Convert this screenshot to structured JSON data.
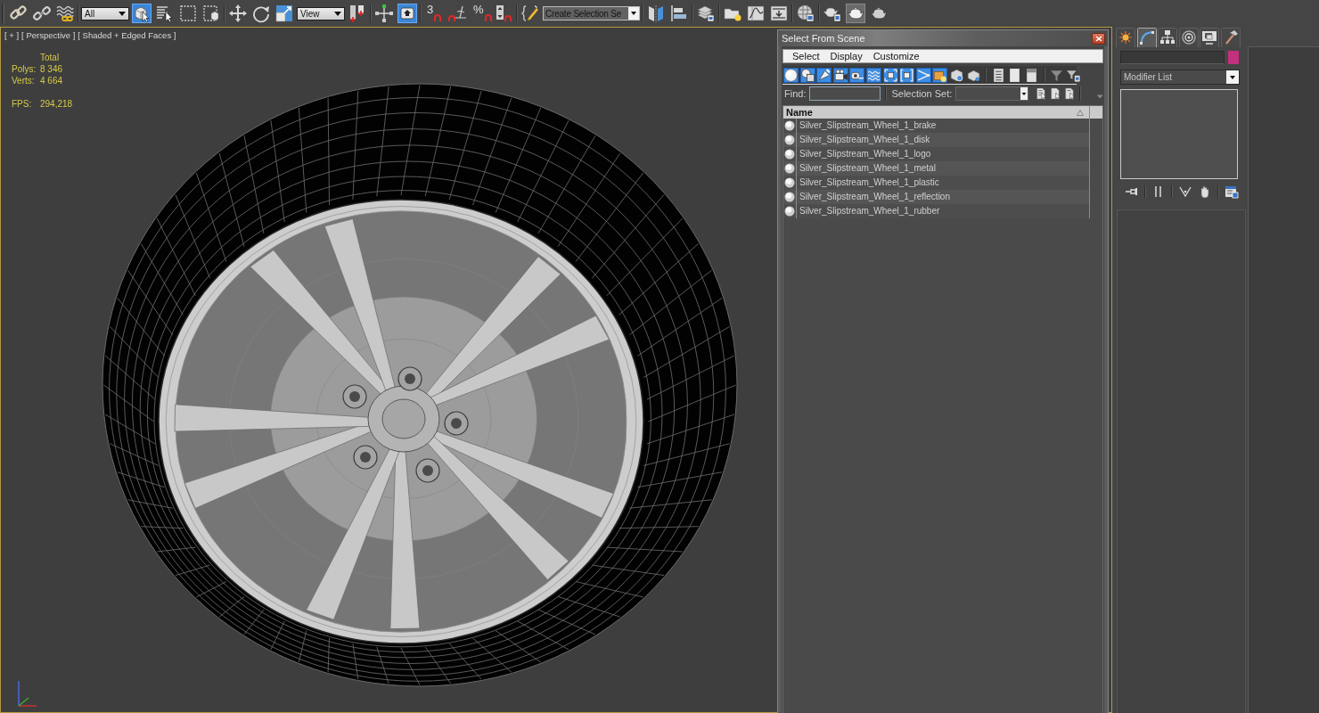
{
  "main_toolbar": {
    "groups": [
      [
        {
          "kind": "button",
          "selected": false,
          "hovered": false
        },
        {
          "kind": "button",
          "selected": false,
          "hovered": false
        },
        {
          "kind": "button",
          "selected": false,
          "hovered": false
        }
      ],
      [
        {
          "kind": "dropdown",
          "value": "All"
        },
        {
          "kind": "button",
          "selected": true,
          "hovered": false
        },
        {
          "kind": "button",
          "selected": false,
          "hovered": false
        },
        {
          "kind": "button",
          "selected": false,
          "hovered": false
        },
        {
          "kind": "button",
          "selected": false,
          "hovered": false
        }
      ],
      [
        {
          "kind": "button",
          "selected": false,
          "hovered": false
        },
        {
          "kind": "button",
          "selected": false,
          "hovered": false
        },
        {
          "kind": "button",
          "selected": false,
          "hovered": false
        },
        {
          "kind": "dropdown",
          "value": "View"
        },
        {
          "kind": "button",
          "selected": false,
          "hovered": false
        }
      ],
      [
        {
          "kind": "button",
          "selected": false,
          "hovered": false
        },
        {
          "kind": "button",
          "selected": true,
          "hovered": false
        }
      ],
      [
        {
          "kind": "snap",
          "label": "3",
          "selected": false,
          "hovered": false
        },
        {
          "kind": "button",
          "selected": false,
          "hovered": false
        },
        {
          "kind": "snap",
          "label": "%",
          "selected": false,
          "hovered": false
        },
        {
          "kind": "button",
          "selected": false,
          "hovered": false
        }
      ],
      [
        {
          "kind": "button",
          "selected": false,
          "hovered": false
        },
        {
          "kind": "combo",
          "placeholder": "Create Selection Se"
        }
      ],
      [
        {
          "kind": "button",
          "selected": false,
          "hovered": false
        },
        {
          "kind": "button",
          "selected": false,
          "hovered": false
        }
      ],
      [
        {
          "kind": "button",
          "selected": false,
          "hovered": false
        }
      ],
      [
        {
          "kind": "button",
          "selected": false,
          "hovered": false
        },
        {
          "kind": "button",
          "selected": false,
          "hovered": false
        },
        {
          "kind": "button",
          "selected": false,
          "hovered": false
        }
      ],
      [
        {
          "kind": "button",
          "selected": false,
          "hovered": false
        }
      ],
      [
        {
          "kind": "button",
          "selected": false,
          "hovered": false
        },
        {
          "kind": "button",
          "selected": false,
          "hovered": true
        },
        {
          "kind": "button",
          "selected": false,
          "hovered": false
        }
      ]
    ]
  },
  "viewport": {
    "active": true,
    "labels": [
      "[ + ]",
      "[ Perspective ]",
      "[ Shaded + Edged Faces ]"
    ],
    "stats": {
      "header": "Total",
      "rows": [
        {
          "label": "Polys:",
          "value": "8 346"
        },
        {
          "label": "Verts:",
          "value": "4 664"
        }
      ],
      "fps": {
        "label": "FPS:",
        "value": "294,218"
      }
    }
  },
  "dialog": {
    "title": "Select From Scene",
    "menu": [
      "Select",
      "Display",
      "Customize"
    ],
    "toolbar": [
      {
        "selected": true
      },
      {
        "selected": true
      },
      {
        "selected": true
      },
      {
        "selected": true
      },
      {
        "selected": true
      },
      {
        "selected": true
      },
      {
        "selected": true
      },
      {
        "selected": true
      },
      {
        "selected": true
      },
      {
        "selected": true
      },
      {
        "selected": false
      },
      {
        "selected": false
      }
    ],
    "find": {
      "label": "Find:"
    },
    "selection_set": {
      "label": "Selection Set:"
    },
    "list": {
      "columns": [
        "Name"
      ],
      "rows": [
        {
          "name": "Silver_Slipstream_Wheel_1_brake",
          "selected": false
        },
        {
          "name": "Silver_Slipstream_Wheel_1_disk",
          "selected": false
        },
        {
          "name": "Silver_Slipstream_Wheel_1_logo",
          "selected": false
        },
        {
          "name": "Silver_Slipstream_Wheel_1_metal",
          "selected": false
        },
        {
          "name": "Silver_Slipstream_Wheel_1_plastic",
          "selected": false
        },
        {
          "name": "Silver_Slipstream_Wheel_1_reflection",
          "selected": false
        },
        {
          "name": "Silver_Slipstream_Wheel_1_rubber",
          "selected": false
        }
      ]
    }
  },
  "command_panel": {
    "tabs": [
      {
        "selected": false
      },
      {
        "selected": true
      },
      {
        "selected": false
      },
      {
        "selected": false
      },
      {
        "selected": false
      },
      {
        "selected": false
      }
    ],
    "modifier_list": {
      "value": "Modifier List"
    }
  }
}
